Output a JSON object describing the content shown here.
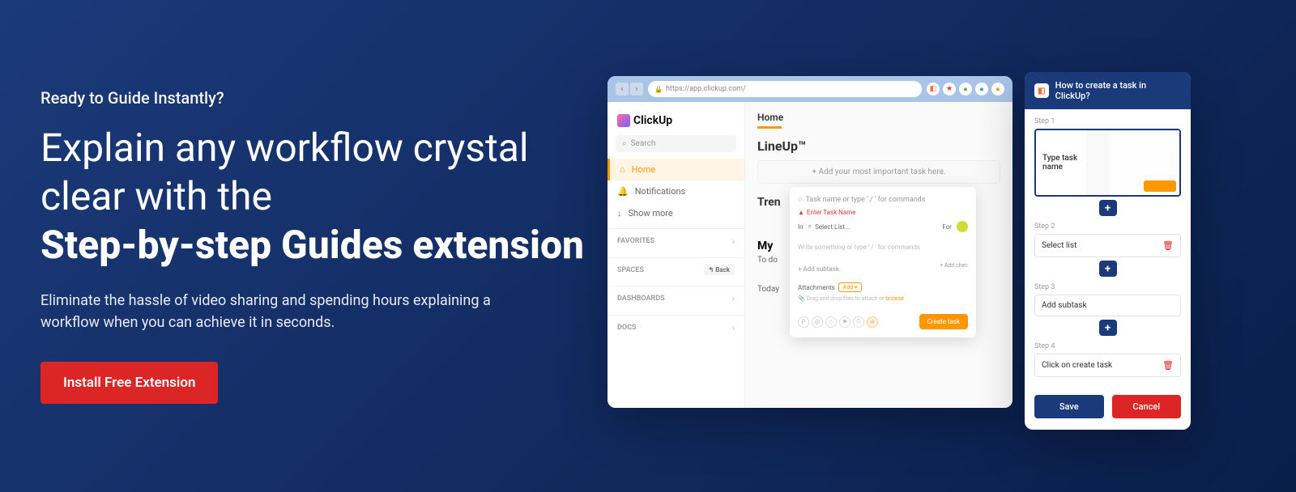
{
  "hero": {
    "eyebrow": "Ready to Guide Instantly?",
    "headline_regular": "Explain any workflow crystal clear with the",
    "headline_bold": "Step-by-step Guides extension",
    "subtext": "Eliminate the hassle of video sharing and spending hours explaining a workflow when you can achieve it in seconds.",
    "cta": "Install Free Extension"
  },
  "browser": {
    "url": "https://app.clickup.com/"
  },
  "clickup": {
    "logo": "ClickUp",
    "search": "Search",
    "nav": {
      "home": "Home",
      "notifications": "Notifications",
      "show_more": "Show more"
    },
    "sections": {
      "favorites": "FAVORITES",
      "spaces": "SPACES",
      "back": "Back",
      "dashboards": "DASHBOARDS",
      "docs": "DOCS"
    },
    "main": {
      "breadcrumb": "Home",
      "lineup": "LineUp™",
      "add_important": "+ Add your most important task here.",
      "trending": "Tren",
      "my_work": "My",
      "todo": "To do",
      "today": "Today"
    },
    "task_modal": {
      "placeholder": "Task name or type ' / ' for commands",
      "error": "Enter Task Name",
      "in": "In",
      "select_list": "Select List...",
      "for": "For",
      "description": "Write something or type ' / ' for commands",
      "add_subtask": "+ Add subtask",
      "add_checklist": "+ Add chec",
      "attachments": "Attachments",
      "add": "Add",
      "drag_drop": "Drag and drop files to attach or",
      "browse": "browse",
      "create": "Create task"
    }
  },
  "guide": {
    "title": "How to create a task in ClickUp?",
    "steps": [
      {
        "label": "Step 1",
        "text": "Type task name"
      },
      {
        "label": "Step 2",
        "text": "Select list"
      },
      {
        "label": "Step 3",
        "text": "Add subtask"
      },
      {
        "label": "Step 4",
        "text": "Click on create task"
      }
    ],
    "save": "Save",
    "cancel": "Cancel"
  }
}
